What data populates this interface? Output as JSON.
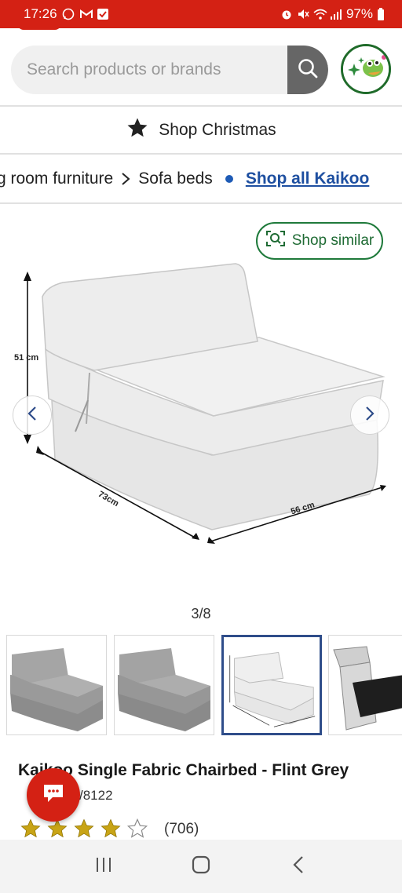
{
  "status_bar": {
    "time": "17:26",
    "battery": "97%",
    "left_icons": [
      "whatsapp-icon",
      "gmail-icon",
      "download-icon"
    ],
    "right_icons": [
      "alarm-icon",
      "mute-icon",
      "wifi-icon",
      "signal-icon",
      "battery-icon"
    ]
  },
  "search": {
    "placeholder": "Search products or brands",
    "value": ""
  },
  "promo": {
    "label": "Shop Christmas"
  },
  "breadcrumb": {
    "items": [
      "g room furniture",
      "Sofa beds"
    ],
    "shop_all": "Shop all Kaikoo"
  },
  "gallery": {
    "shop_similar": "Shop similar",
    "counter": "3/8",
    "current_index": 3,
    "total": 8,
    "dimensions": {
      "height": "51 cm",
      "depth": "73cm",
      "width": "56 cm"
    }
  },
  "product": {
    "title": "Kaikoo Single Fabric Chairbed - Flint Grey",
    "sku_partial": "/8122",
    "rating": 4,
    "rating_max": 5,
    "review_count": "(706)"
  },
  "colors": {
    "brand_red": "#d42114",
    "link_blue": "#1e4fa0",
    "accent_green": "#1f7a3b",
    "star_gold": "#c8a416"
  }
}
